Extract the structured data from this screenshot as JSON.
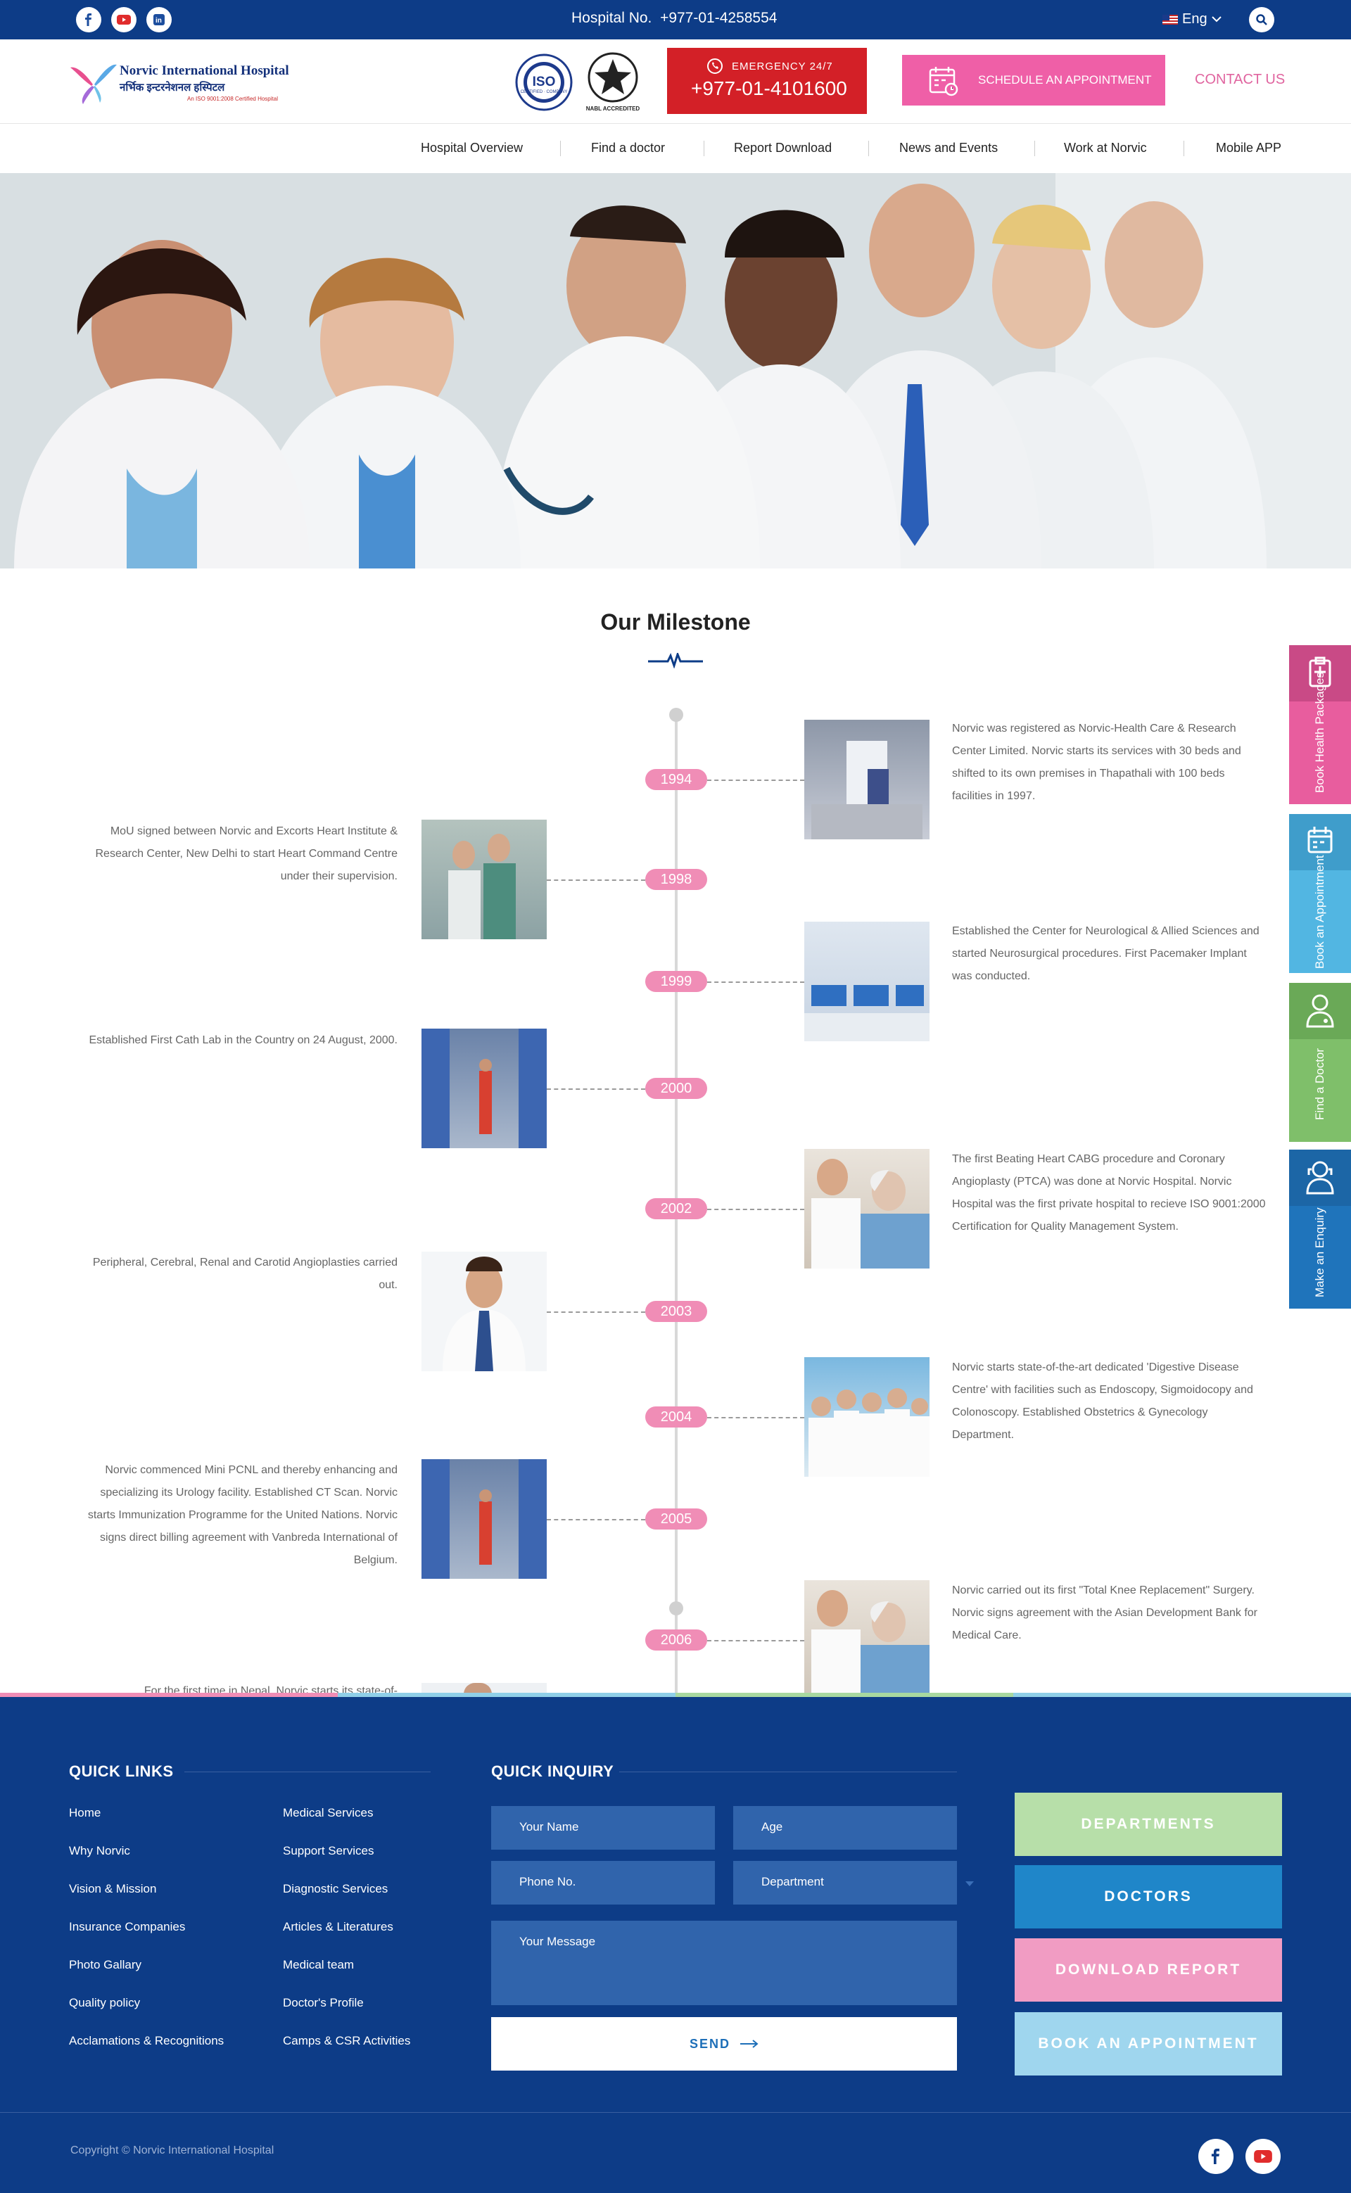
{
  "topbar": {
    "hospital_label": "Hospital No.",
    "hospital_number": "+977-01-4258554",
    "language": "Eng",
    "social": [
      "facebook-icon",
      "youtube-icon",
      "linkedin-icon"
    ]
  },
  "header": {
    "logo_name": "Norvic International Hospital",
    "logo_sub": "नर्भिक इन्टरनेशनल हस्पिटल",
    "logo_cert": "An ISO 9001:2008 Certified Hospital",
    "badge_iso": "ISO",
    "badge_iso_small": "CERTIFIED · COMPANY",
    "badge_nabl": "NABL ACCREDITED",
    "emergency_label": "EMERGENCY 24/7",
    "emergency_number": "+977-01-4101600",
    "schedule_label": "SCHEDULE AN APPOINTMENT",
    "contact_label": "CONTACT US"
  },
  "nav": [
    {
      "label": "Hospital Overview"
    },
    {
      "label": "Find a doctor"
    },
    {
      "label": "Report Download"
    },
    {
      "label": "News and Events"
    },
    {
      "label": "Work at Norvic"
    },
    {
      "label": "Mobile APP"
    }
  ],
  "milestone": {
    "title": "Our Milestone",
    "items": [
      {
        "year": "1994",
        "side": "right",
        "text": "Norvic was registered as Norvic-Health Care & Research Center Limited. Norvic starts its services with 30 beds and shifted to its own premises in Thapathali with 100 beds facilities in 1997."
      },
      {
        "year": "1998",
        "side": "left",
        "text": "MoU signed between Norvic and Excorts Heart Institute & Research Center, New Delhi to start Heart Command Centre under their supervision."
      },
      {
        "year": "1999",
        "side": "right",
        "text": "Established the Center for Neurological & Allied Sciences and started Neurosurgical procedures. First Pacemaker Implant was conducted."
      },
      {
        "year": "2000",
        "side": "left",
        "text": "Established First Cath Lab in the Country on 24 August, 2000."
      },
      {
        "year": "2002",
        "side": "right",
        "text": "The first Beating Heart CABG procedure and Coronary Angioplasty (PTCA) was done at Norvic Hospital. Norvic Hospital was the first private hospital to recieve  ISO 9001:2000 Certification for Quality Management System."
      },
      {
        "year": "2003",
        "side": "left",
        "text": "Peripheral, Cerebral, Renal and Carotid Angioplasties carried out."
      },
      {
        "year": "2004",
        "side": "right",
        "text": "Norvic starts state-of-the-art dedicated 'Digestive Disease Centre' with facilities such as Endoscopy, Sigmoidocopy and Colonoscopy. Established Obstetrics & Gynecology Department."
      },
      {
        "year": "2005",
        "side": "left",
        "text": "Norvic commenced Mini PCNL and thereby enhancing and specializing its Urology facility. Established CT Scan. Norvic starts Immunization Programme for the United Nations. Norvic signs direct billing agreement with Vanbreda International of Belgium."
      },
      {
        "year": "2006",
        "side": "right",
        "text": "Norvic carried out its first \"Total Knee Replacement\" Surgery. Norvic signs agreement with the Asian Development Bank for Medical Care."
      },
      {
        "year": "",
        "side": "left",
        "text": "For the first time in Nepal, Norvic starts its state-of-"
      }
    ]
  },
  "side_tabs": [
    {
      "label": "Book Health Packages",
      "color": "#e85d9e",
      "icon": "clipboard-icon"
    },
    {
      "label": "Book an Appointment",
      "color": "#52b6e2",
      "icon": "calendar-icon"
    },
    {
      "label": "Find a Doctor",
      "color": "#7fbf6a",
      "icon": "doctor-icon"
    },
    {
      "label": "Make an Enquiry",
      "color": "#1f74bb",
      "icon": "enquiry-icon"
    }
  ],
  "footer": {
    "quick_links_title": "QUICK LINKS",
    "links_col1": [
      "Home",
      "Why Norvic",
      "Vision & Mission",
      "Insurance Companies",
      "Photo Gallary",
      "Quality policy",
      "Acclamations & Recognitions"
    ],
    "links_col2": [
      "Medical Services",
      "Support Services",
      "Diagnostic Services",
      "Articles & Literatures",
      "Medical team",
      "Doctor's Profile",
      "Camps & CSR Activities"
    ],
    "inquiry_title": "QUICK INQUIRY",
    "name_placeholder": "Your Name",
    "age_placeholder": "Age",
    "phone_placeholder": "Phone No.",
    "department_placeholder": "Department",
    "message_placeholder": "Your Message",
    "send_label": "SEND",
    "buttons": [
      {
        "label": "DEPARTMENTS",
        "color": "#b7dfa9"
      },
      {
        "label": "DOCTORS",
        "color": "#1f86c9"
      },
      {
        "label": "DOWNLOAD REPORT",
        "color": "#f19cc3"
      },
      {
        "label": "BOOK AN APPOINTMENT",
        "color": "#9fd6ee"
      }
    ],
    "copyright": "Copyright © Norvic International Hospital"
  }
}
